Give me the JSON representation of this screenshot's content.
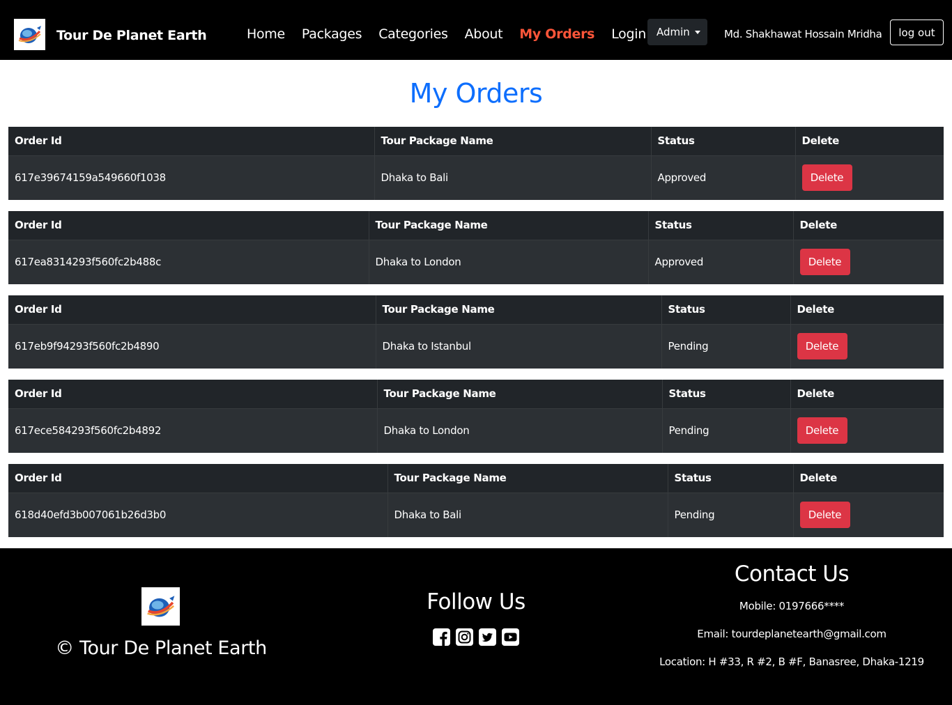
{
  "navbar": {
    "brand_name": "Tour De Planet Earth",
    "links": [
      {
        "label": "Home"
      },
      {
        "label": "Packages"
      },
      {
        "label": "Categories"
      },
      {
        "label": "About"
      },
      {
        "label": "My Orders",
        "active": true
      },
      {
        "label": "Login"
      }
    ],
    "admin_label": "Admin",
    "user_name": "Md. Shakhawat Hossain Mridha",
    "logout_label": "log out",
    "active_color": "#fd5539"
  },
  "page_title": "My Orders",
  "table_headers": {
    "order_id": "Order Id",
    "package_name": "Tour Package Name",
    "status": "Status",
    "delete": "Delete"
  },
  "delete_label": "Delete",
  "orders": [
    {
      "order_id": "617e39674159a549660f1038",
      "package_name": "Dhaka to Bali",
      "status": "Approved"
    },
    {
      "order_id": "617ea8314293f560fc2b488c",
      "package_name": "Dhaka to London",
      "status": "Approved"
    },
    {
      "order_id": "617eb9f94293f560fc2b4890",
      "package_name": "Dhaka to Istanbul",
      "status": "Pending"
    },
    {
      "order_id": "617ece584293f560fc2b4892",
      "package_name": "Dhaka to London",
      "status": "Pending"
    },
    {
      "order_id": "618d40efd3b007061b26d3b0",
      "package_name": "Dhaka to Bali",
      "status": "Pending"
    }
  ],
  "footer": {
    "copyright": "© Tour De Planet Earth",
    "follow_title": "Follow Us",
    "social_icons": [
      "facebook-icon",
      "instagram-icon",
      "twitter-icon",
      "youtube-icon"
    ],
    "contact_title": "Contact Us",
    "mobile": "Mobile: 0197666****",
    "email_label": "Email:",
    "email": "tourdeplanetearth@gmail.com",
    "location_label": "Location:",
    "location": "H #33, R #2, B #F, Banasree, Dhaka-1219"
  },
  "colors": {
    "title_blue": "#0d6efd",
    "delete_red": "#dc3545",
    "table_dark": "#212529"
  }
}
